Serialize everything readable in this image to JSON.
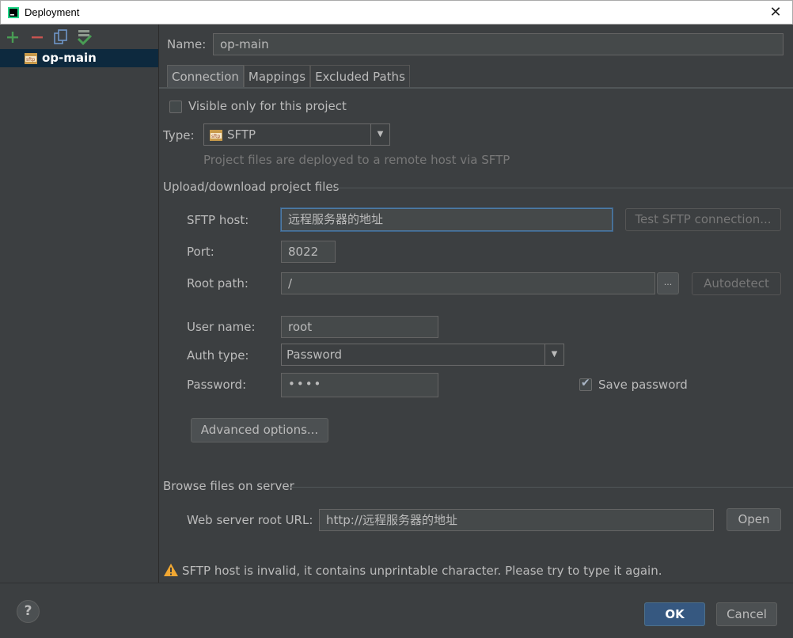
{
  "window": {
    "title": "Deployment",
    "close_glyph": "✕"
  },
  "left": {
    "toolbar": [
      "add-icon",
      "remove-icon",
      "copy-icon",
      "set-default-icon"
    ],
    "tree_items": [
      {
        "label": "op-main",
        "icon": "sftp-server-icon"
      }
    ]
  },
  "form": {
    "name_label": "Name:",
    "name_value": "op-main",
    "tabs": [
      "Connection",
      "Mappings",
      "Excluded Paths"
    ],
    "visible_only_label": "Visible only for this project",
    "type_label": "Type:",
    "type_value": "SFTP",
    "type_hint": "Project files are deployed to a remote host via SFTP",
    "upload_section": "Upload/download project files",
    "sftp_host_label": "SFTP host:",
    "sftp_host_value": "远程服务器的地址",
    "test_button": "Test SFTP connection...",
    "port_label": "Port:",
    "port_value": "8022",
    "root_path_label": "Root path:",
    "root_path_value": "/",
    "browse_button": "...",
    "autodetect_button": "Autodetect",
    "user_name_label": "User name:",
    "user_name_value": "root",
    "auth_type_label": "Auth type:",
    "auth_type_value": "Password",
    "password_label": "Password:",
    "password_value": "••••",
    "save_password_label": "Save password",
    "advanced_button": "Advanced options...",
    "browse_section": "Browse files on server",
    "web_root_label": "Web server root URL:",
    "web_root_value": "http://远程服务器的地址",
    "open_button": "Open",
    "warning_text": "SFTP host is invalid, it contains unprintable character. Please try to type it again."
  },
  "footer": {
    "help": "?",
    "ok": "OK",
    "cancel": "Cancel"
  },
  "colors": {
    "background": "#3c3f41",
    "selection": "#0d293e",
    "accent": "#365880",
    "warning": "#f0a732"
  }
}
